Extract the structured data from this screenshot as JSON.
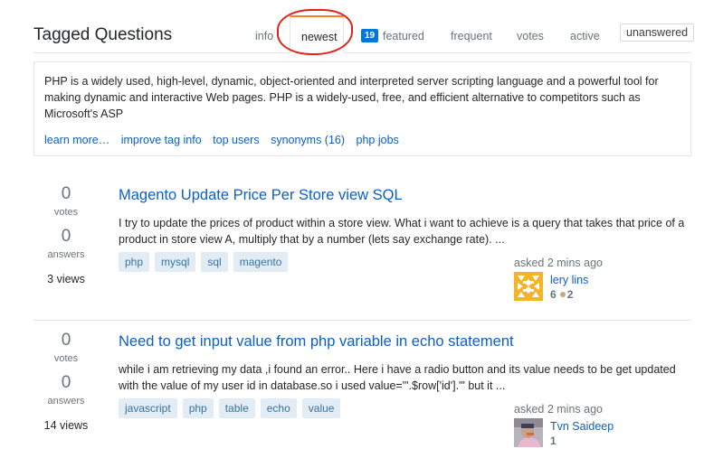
{
  "header": {
    "title": "Tagged Questions",
    "tabs": {
      "info": "info",
      "newest": "newest",
      "featured_count": "19",
      "featured": "featured",
      "frequent": "frequent",
      "votes": "votes",
      "active": "active",
      "unanswered": "unanswered"
    }
  },
  "tag_info": {
    "description": "PHP is a widely used, high-level, dynamic, object-oriented and interpreted server scripting language and a powerful tool for making dynamic and interactive Web pages. PHP is a widely-used, free, and efficient alternative to competitors such as Microsoft's ASP",
    "links": [
      "learn more…",
      "improve tag info",
      "top users",
      "synonyms (16)",
      "php jobs"
    ]
  },
  "questions": [
    {
      "votes": "0",
      "votes_label": "votes",
      "answers": "0",
      "answers_label": "answers",
      "views": "3 views",
      "title": "Magento Update Price Per Store view SQL",
      "excerpt": "I try to update the prices of product within a store view. What i want to achieve is a query that takes that price of a product in store view A, multiply that by a number (lets say exchange rate). ...",
      "tags": [
        "php",
        "mysql",
        "sql",
        "magento"
      ],
      "asked": "asked 2 mins ago",
      "user": {
        "name": "lery lins",
        "rep": "6",
        "bronze": "2"
      }
    },
    {
      "votes": "0",
      "votes_label": "votes",
      "answers": "0",
      "answers_label": "answers",
      "views": "14 views",
      "title": "Need to get input value from php variable in echo statement",
      "excerpt": "while i am retrieving my data ,i found an error.. Here i have a radio button and its value needs to be get updated with the value of my user id in database.so i used value=\"'.$row['id'].'\" but it ...",
      "tags": [
        "javascript",
        "php",
        "table",
        "echo",
        "value"
      ],
      "asked": "asked 2 mins ago",
      "user": {
        "name": "Tvn Saideep",
        "rep": "1"
      }
    }
  ]
}
